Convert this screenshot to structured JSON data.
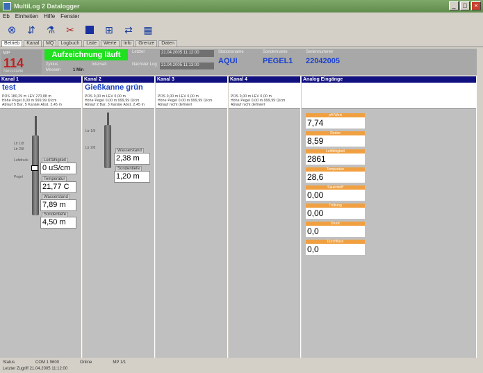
{
  "window": {
    "title": "MultiLog 2 Datalogger",
    "buttons": [
      "_",
      "□",
      "×"
    ]
  },
  "menu": [
    "Eb",
    "Einheiten",
    "Hilfe",
    "Fenster"
  ],
  "toolbar": [
    {
      "name": "stop-icon",
      "glyph": "⊗"
    },
    {
      "name": "read-icon",
      "glyph": "⇵"
    },
    {
      "name": "probe-icon",
      "glyph": "⚗"
    },
    {
      "name": "tool-icon",
      "glyph": "✂"
    },
    {
      "name": "square-icon",
      "glyph": ""
    },
    {
      "name": "grid-icon",
      "glyph": "⊞"
    },
    {
      "name": "chart-icon",
      "glyph": "⇄"
    },
    {
      "name": "table-icon",
      "glyph": "▦"
    }
  ],
  "tabs": [
    "Betrieb",
    "Kanal",
    "MQ",
    "Logbuch",
    "Liste",
    "Werte",
    "Info",
    "Grenze",
    "Daten"
  ],
  "info": {
    "mp_caption": "MP",
    "mp_value": "114",
    "mp_sub": "Messstelle",
    "status": "Aufzeichnung läuft",
    "status_sub1": "Zyklus",
    "status_sub2": "Messen",
    "status_sub3": "Intervall",
    "status_sub3_val": "1 Min",
    "start_caption": "Letzter",
    "start_value": "21.04.2005 11:12:00",
    "next_caption": "Nächster Log",
    "next_value": "21.04.2005 11:13:00",
    "station_caption": "Stationsname",
    "station_value": "AQUI",
    "probe_caption": "Sondenname",
    "probe_value": "PEGEL1",
    "serial_caption": "Seriennummer",
    "serial_value": "22042005"
  },
  "panels": [
    {
      "header": "Kanal 1",
      "name": "test",
      "lines": [
        "POS 180,29 m  LEV 270,88 m",
        "Höhe Pegel 0,00 m   999,99 Ω/cm",
        "Ablauf 5 Bar, 5 Kanäle Abst. 2,45 m"
      ],
      "left_labels": [
        "Ltr 1/8",
        "Ltr 2/8"
      ],
      "left_labels2": [
        "Luftdruck",
        "Pegel"
      ],
      "gauges": [
        {
          "caption": "Leitfähigkeit",
          "value": "0 uS/cm"
        },
        {
          "caption": "Temperatur",
          "value": "21,77 C"
        },
        {
          "caption": "Wasserstand",
          "value": "7,89 m"
        },
        {
          "caption": "Sondentiefe",
          "value": "4,50 m"
        }
      ]
    },
    {
      "header": "Kanal 2",
      "name": "Gießkanne grün",
      "lines": [
        "POS 0,00 m  LEV 0,00 m",
        "Höhe Pegel 0,00 m   999,99 Ω/cm",
        "Ablauf 2 Bar, 3 Kanäle Abst. 2,45 m"
      ],
      "left_labels": [
        "Ltr 1/8",
        "Ltr 2/8"
      ],
      "gauges": [
        {
          "caption": "Wasserstand",
          "value": "2,38 m"
        },
        {
          "caption": "Sondentiefe",
          "value": "1,20 m"
        }
      ]
    },
    {
      "header": "Kanal 3",
      "lines": [
        "POS 0,00 m  LEV 0,00 m",
        "Höhe Pegel 0,00 m   999,99 Ω/cm",
        "Ablauf nicht definiert"
      ]
    },
    {
      "header": "Kanal 4",
      "lines": [
        "POS 0,00 m  LEV 0,00 m",
        "Höhe Pegel 0,00 m   999,99 Ω/cm",
        "Ablauf nicht definiert"
      ]
    },
    {
      "header": "Analog Eingänge"
    }
  ],
  "analog": [
    {
      "caption": "pH-Wert",
      "value": "7,74"
    },
    {
      "caption": "Redox",
      "value": "8,59"
    },
    {
      "caption": "Leitfähigkeit",
      "value": "2861"
    },
    {
      "caption": "Temperatur",
      "value": "28,6"
    },
    {
      "caption": "Sauerstoff",
      "value": "0,00"
    },
    {
      "caption": "Trübung",
      "value": "0,00"
    },
    {
      "caption": "Druck",
      "value": "0,0"
    },
    {
      "caption": "Durchfluss",
      "value": "0,0"
    }
  ],
  "status": {
    "left": "Status",
    "mid1": "COM 1 9600",
    "mid2": "Online",
    "mid3": "MP 1/1",
    "line2": "Letzter Zugriff 21.04.2005 11:12:00"
  }
}
